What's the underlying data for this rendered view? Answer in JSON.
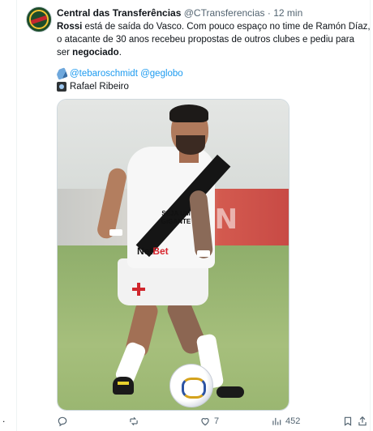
{
  "tweet": {
    "display_name": "Central das Transferências",
    "handle": "@CTransferencias",
    "separator": "·",
    "time": "12 min",
    "text_line1_bold": "Rossi",
    "text_line1_rest": " está de saída do Vasco. Com pouco espaço no time de Ramón Díaz,",
    "text_line2": "o atacante de 30 anos recebeu propostas de outros clubes e pediu para",
    "text_line3_pre": "ser ",
    "text_line3_bold": "negociado",
    "text_line3_post": ".",
    "credit_links": "@tebaroschmidt @geglobo",
    "credit_photo": "Rafael Ribeiro"
  },
  "photo": {
    "shirt_sponsor_top": "SEJA UM",
    "shirt_sponsor_bottom": "GIGANTE",
    "shirt_sponsor_main_a": "Net",
    "shirt_sponsor_main_b": "Bet",
    "stadium_banner": "4N"
  },
  "actions": {
    "reply_count": "",
    "retweet_count": "",
    "like_count": "7",
    "views_count": "452"
  },
  "side_marker": "."
}
